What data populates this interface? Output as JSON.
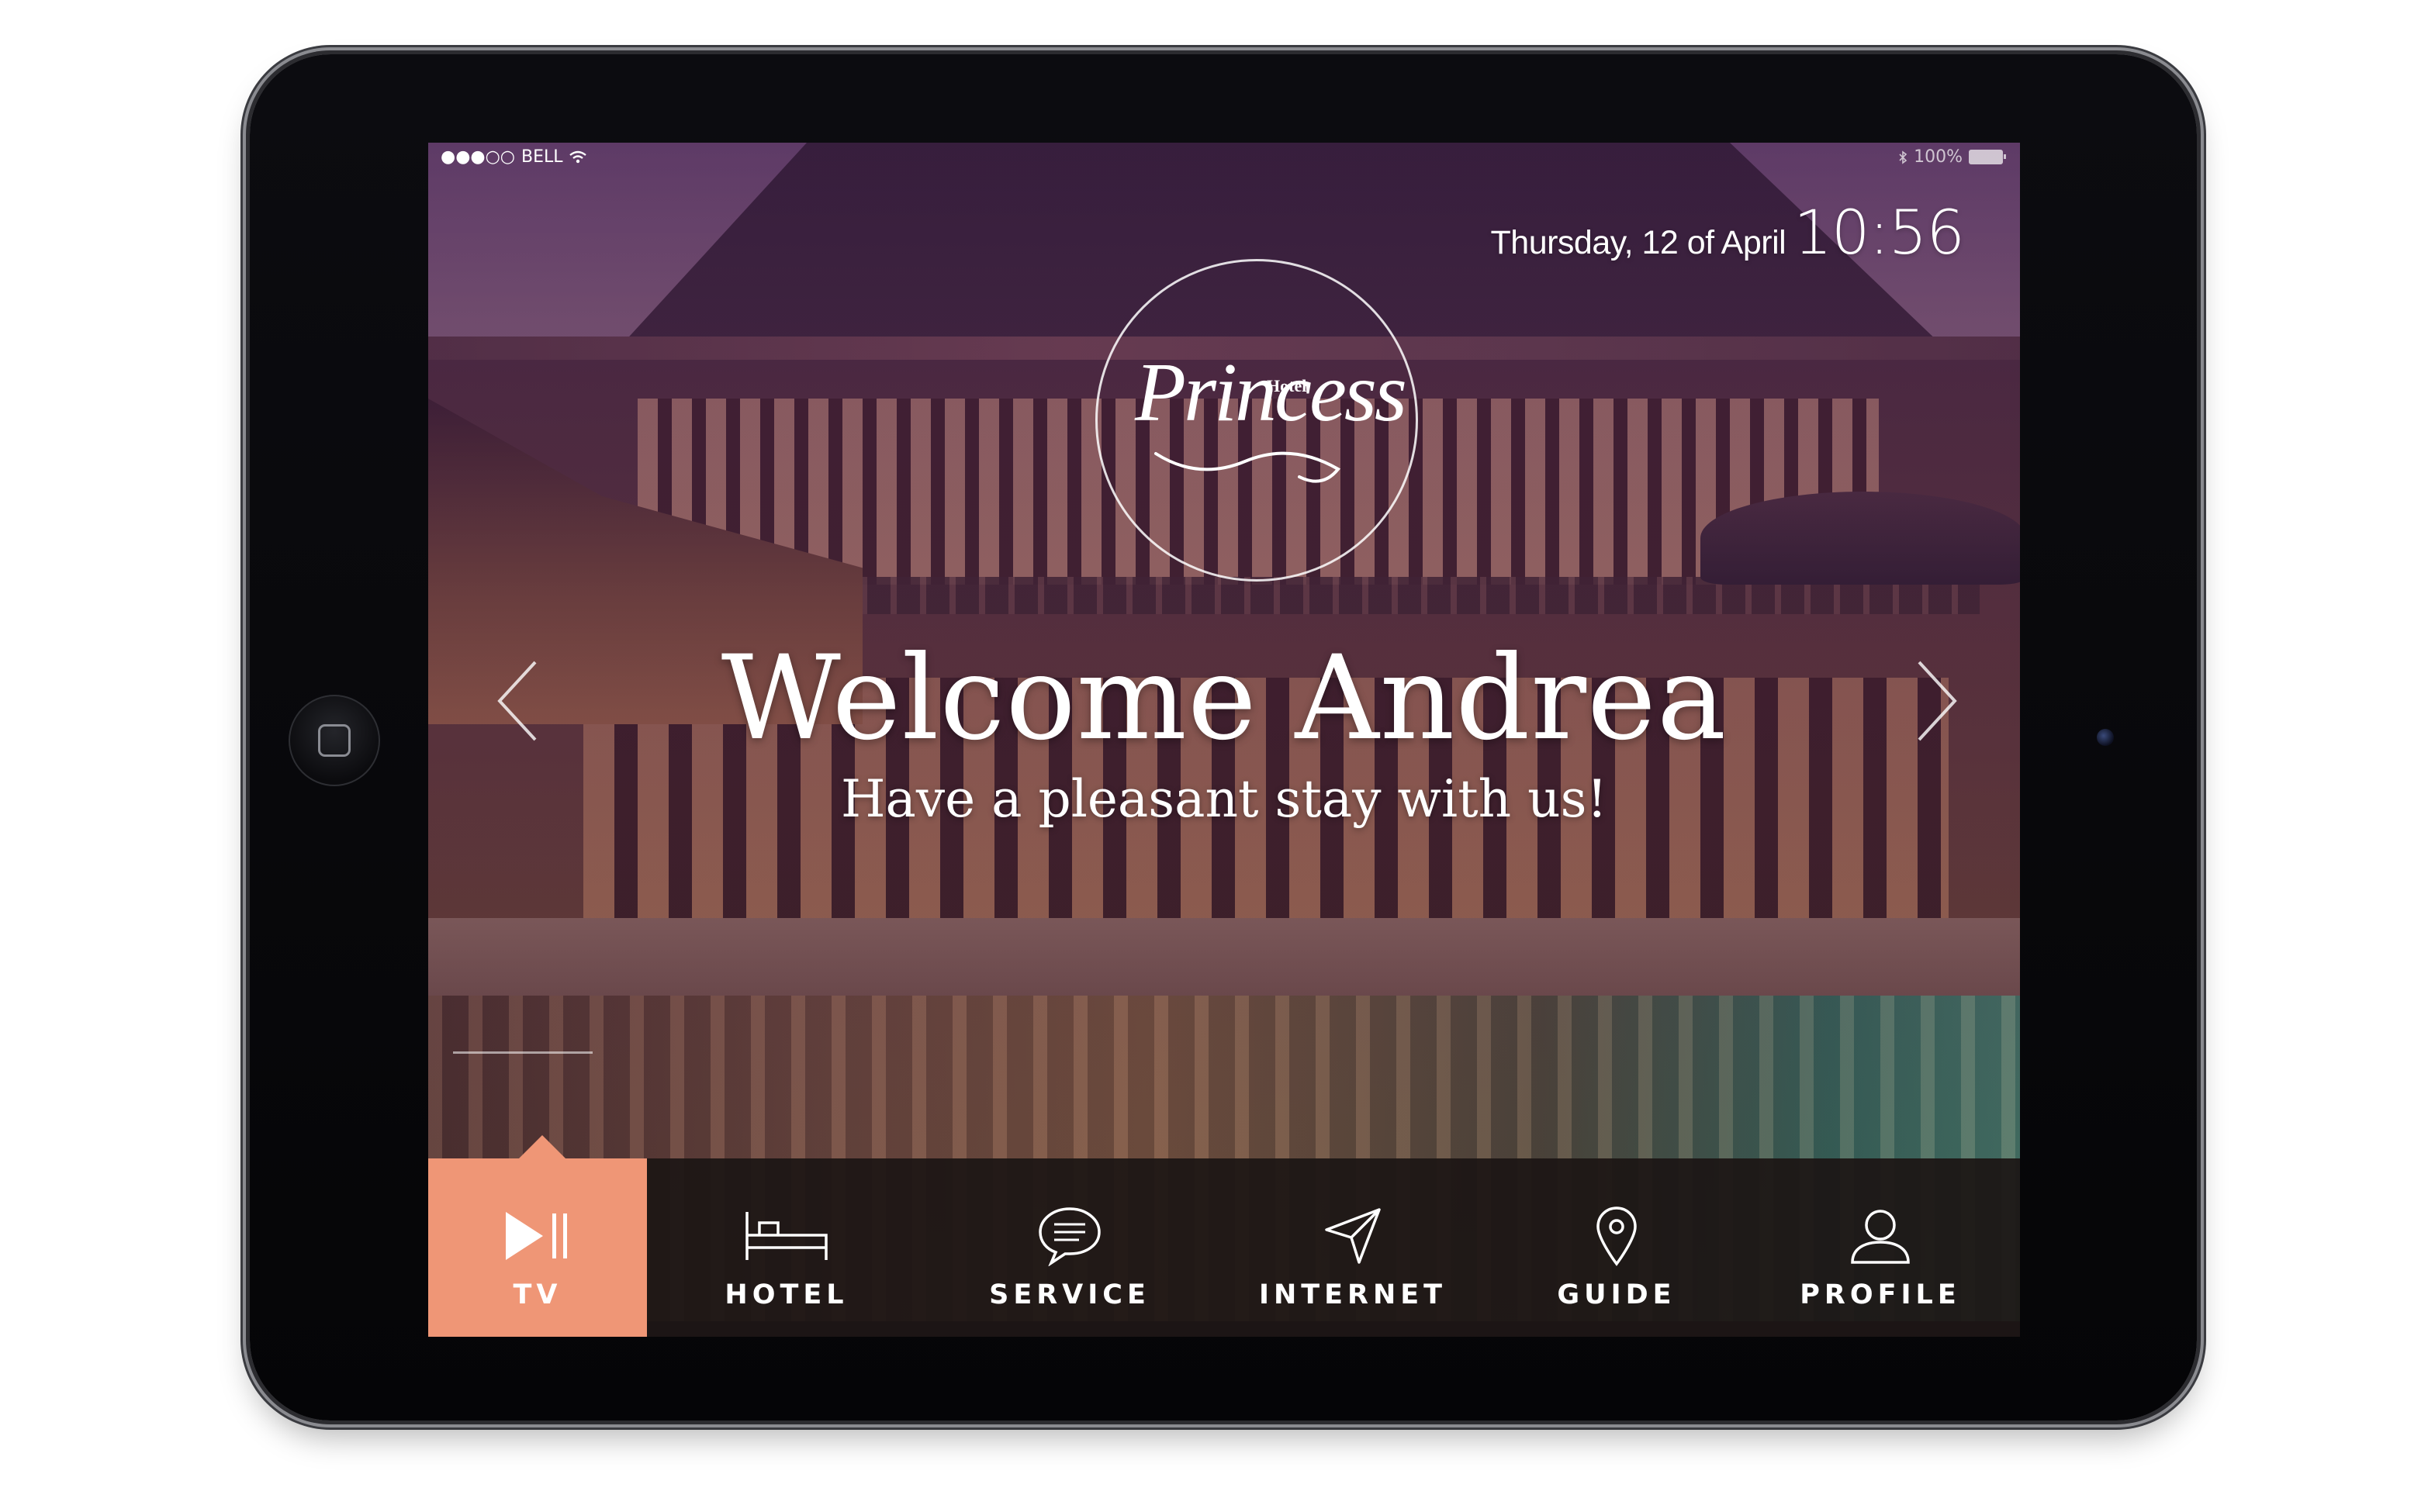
{
  "status_bar": {
    "signal": "●●●○○",
    "carrier": "BELL",
    "battery_percent": "100%"
  },
  "clock": {
    "date": "Thursday, 12 of April",
    "time": "10:56"
  },
  "logo": {
    "small_text": "Hotel",
    "main_text": "Princess"
  },
  "hero": {
    "welcome": "Welcome Andrea",
    "subtitle": "Have a pleasant stay with us!"
  },
  "nav": {
    "active_index": 0,
    "items": [
      {
        "label": "TV",
        "icon": "play-pause-icon"
      },
      {
        "label": "HOTEL",
        "icon": "bed-icon"
      },
      {
        "label": "SERVICE",
        "icon": "chat-bubble-icon"
      },
      {
        "label": "INTERNET",
        "icon": "paper-plane-icon"
      },
      {
        "label": "GUIDE",
        "icon": "map-pin-icon"
      },
      {
        "label": "PROFILE",
        "icon": "user-icon"
      }
    ]
  },
  "colors": {
    "accent": "#ef9676",
    "nav_background": "#1c1614",
    "overlay_tint": "#46144a"
  }
}
